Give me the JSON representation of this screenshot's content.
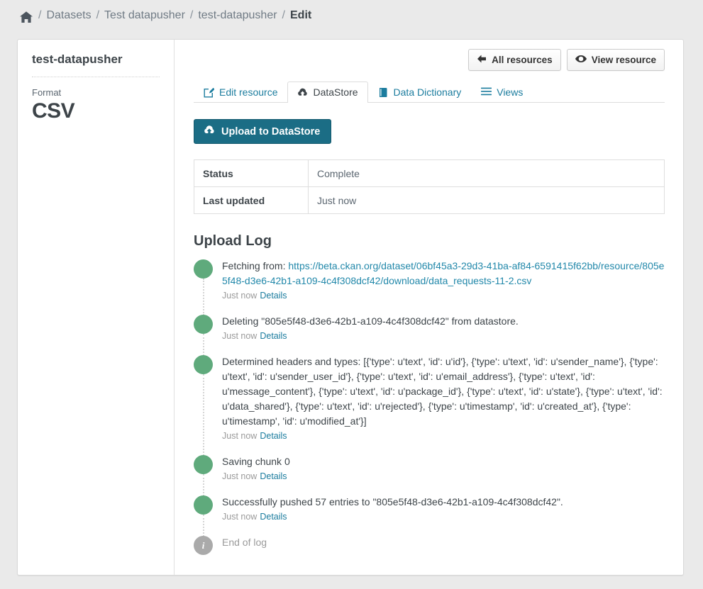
{
  "breadcrumb": {
    "home_icon": "home-icon",
    "items": [
      {
        "label": "Datasets",
        "active": false
      },
      {
        "label": "Test datapusher",
        "active": false
      },
      {
        "label": "test-datapusher",
        "active": false
      },
      {
        "label": "Edit",
        "active": true
      }
    ],
    "separator": "/"
  },
  "sidebar": {
    "resource_title": "test-datapusher",
    "format_label": "Format",
    "format_value": "CSV"
  },
  "actions": {
    "all_resources": {
      "label": "All resources",
      "icon": "arrow-left-icon"
    },
    "view_resource": {
      "label": "View resource",
      "icon": "eye-icon"
    }
  },
  "tabs": [
    {
      "label": "Edit resource",
      "icon": "pencil-square-icon",
      "active": false
    },
    {
      "label": "DataStore",
      "icon": "cloud-upload-icon",
      "active": true
    },
    {
      "label": "Data Dictionary",
      "icon": "book-icon",
      "active": false
    },
    {
      "label": "Views",
      "icon": "list-icon",
      "active": false
    }
  ],
  "upload_button": {
    "label": "Upload to DataStore",
    "icon": "cloud-upload-icon",
    "color": "#1b6d85"
  },
  "status_table": {
    "rows": [
      {
        "key": "Status",
        "value": "Complete"
      },
      {
        "key": "Last updated",
        "value": "Just now"
      }
    ]
  },
  "upload_log": {
    "title": "Upload Log",
    "details_label": "Details",
    "dot_color": "#5faa7c",
    "info_dot_color": "#aaaaaa",
    "entries": [
      {
        "prefix": "Fetching from: ",
        "url": "https://beta.ckan.org/dataset/06bf45a3-29d3-41ba-af84-6591415f62bb/resource/805e5f48-d3e6-42b1-a109-4c4f308dcf42/download/data_requests-11-2.csv",
        "time": "Just now",
        "type": "success"
      },
      {
        "message": "Deleting \"805e5f48-d3e6-42b1-a109-4c4f308dcf42\" from datastore.",
        "time": "Just now",
        "type": "success"
      },
      {
        "message": "Determined headers and types: [{'type': u'text', 'id': u'id'}, {'type': u'text', 'id': u'sender_name'}, {'type': u'text', 'id': u'sender_user_id'}, {'type': u'text', 'id': u'email_address'}, {'type': u'text', 'id': u'message_content'}, {'type': u'text', 'id': u'package_id'}, {'type': u'text', 'id': u'state'}, {'type': u'text', 'id': u'data_shared'}, {'type': u'text', 'id': u'rejected'}, {'type': u'timestamp', 'id': u'created_at'}, {'type': u'timestamp', 'id': u'modified_at'}]",
        "time": "Just now",
        "type": "success"
      },
      {
        "message": "Saving chunk 0",
        "time": "Just now",
        "type": "success"
      },
      {
        "message": "Successfully pushed 57 entries to \"805e5f48-d3e6-42b1-a109-4c4f308dcf42\".",
        "time": "Just now",
        "type": "success"
      },
      {
        "message": "End of log",
        "type": "info",
        "icon": "info-icon"
      }
    ]
  }
}
